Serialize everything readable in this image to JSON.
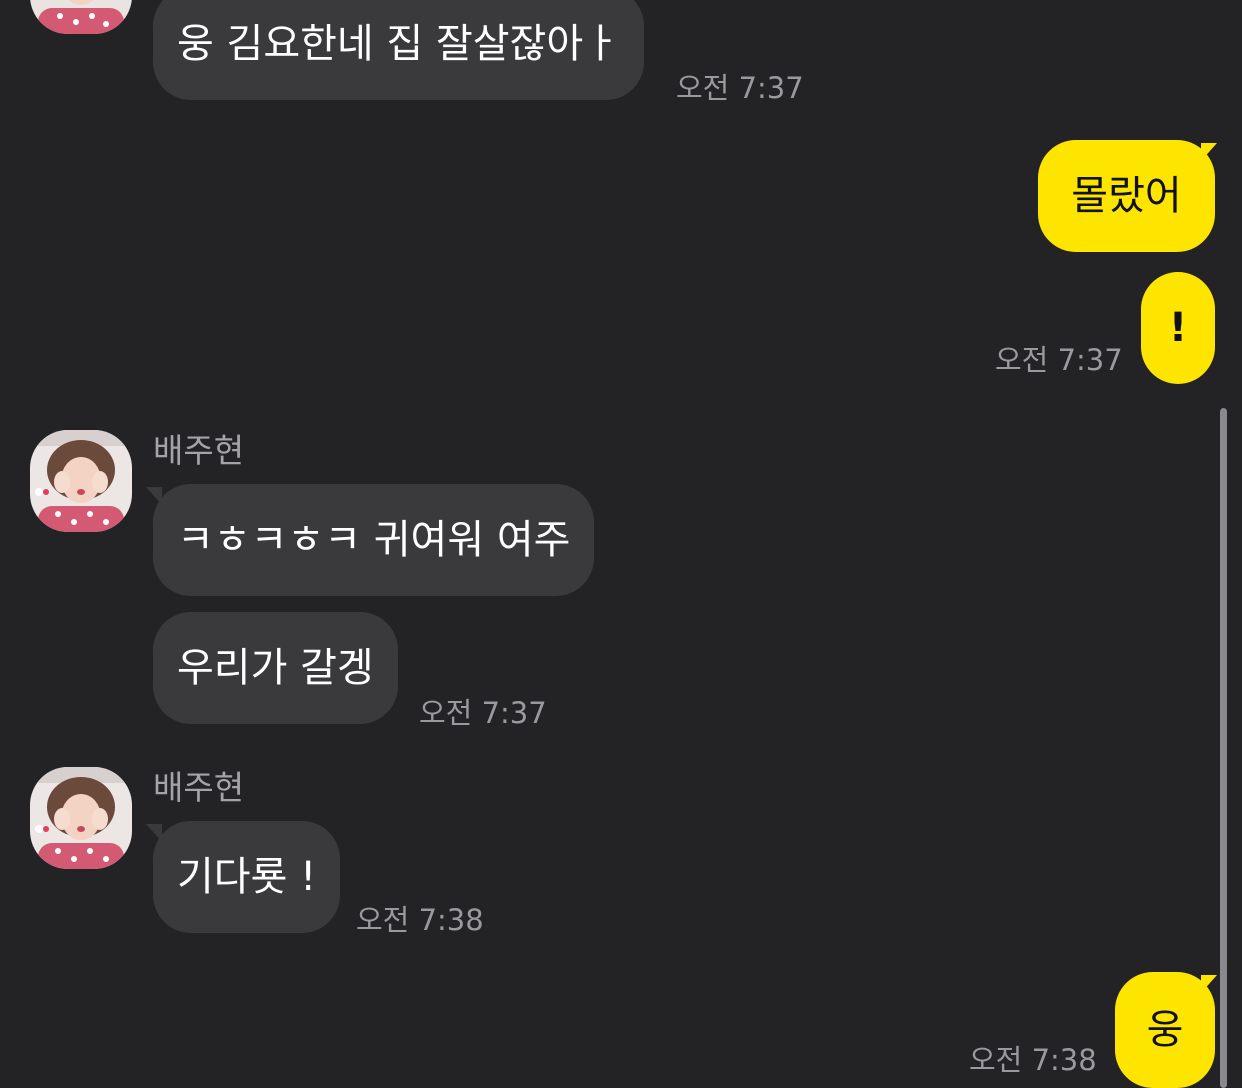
{
  "colors": {
    "background": "#232326",
    "incoming_bubble": "#3a3a3d",
    "outgoing_bubble": "#fee500",
    "timestamp": "#9a9a9e",
    "sender_name": "#a3a3a8"
  },
  "messages": [
    {
      "direction": "in",
      "text": "웅 김요한네 집 잘살잖아ㅏ",
      "time": "오전 7:37"
    },
    {
      "direction": "out",
      "text": "몰랐어"
    },
    {
      "direction": "out",
      "text": "!",
      "time": "오전 7:37"
    },
    {
      "direction": "in",
      "sender": "배주현",
      "text": "ㅋㅎㅋㅎㅋ 귀여워 여주"
    },
    {
      "direction": "in",
      "text": "우리가 갈겡",
      "time": "오전 7:37"
    },
    {
      "direction": "in",
      "sender": "배주현",
      "text": "기다룟 !",
      "time": "오전 7:38"
    },
    {
      "direction": "out",
      "text": "웅",
      "time": "오전 7:38"
    }
  ]
}
